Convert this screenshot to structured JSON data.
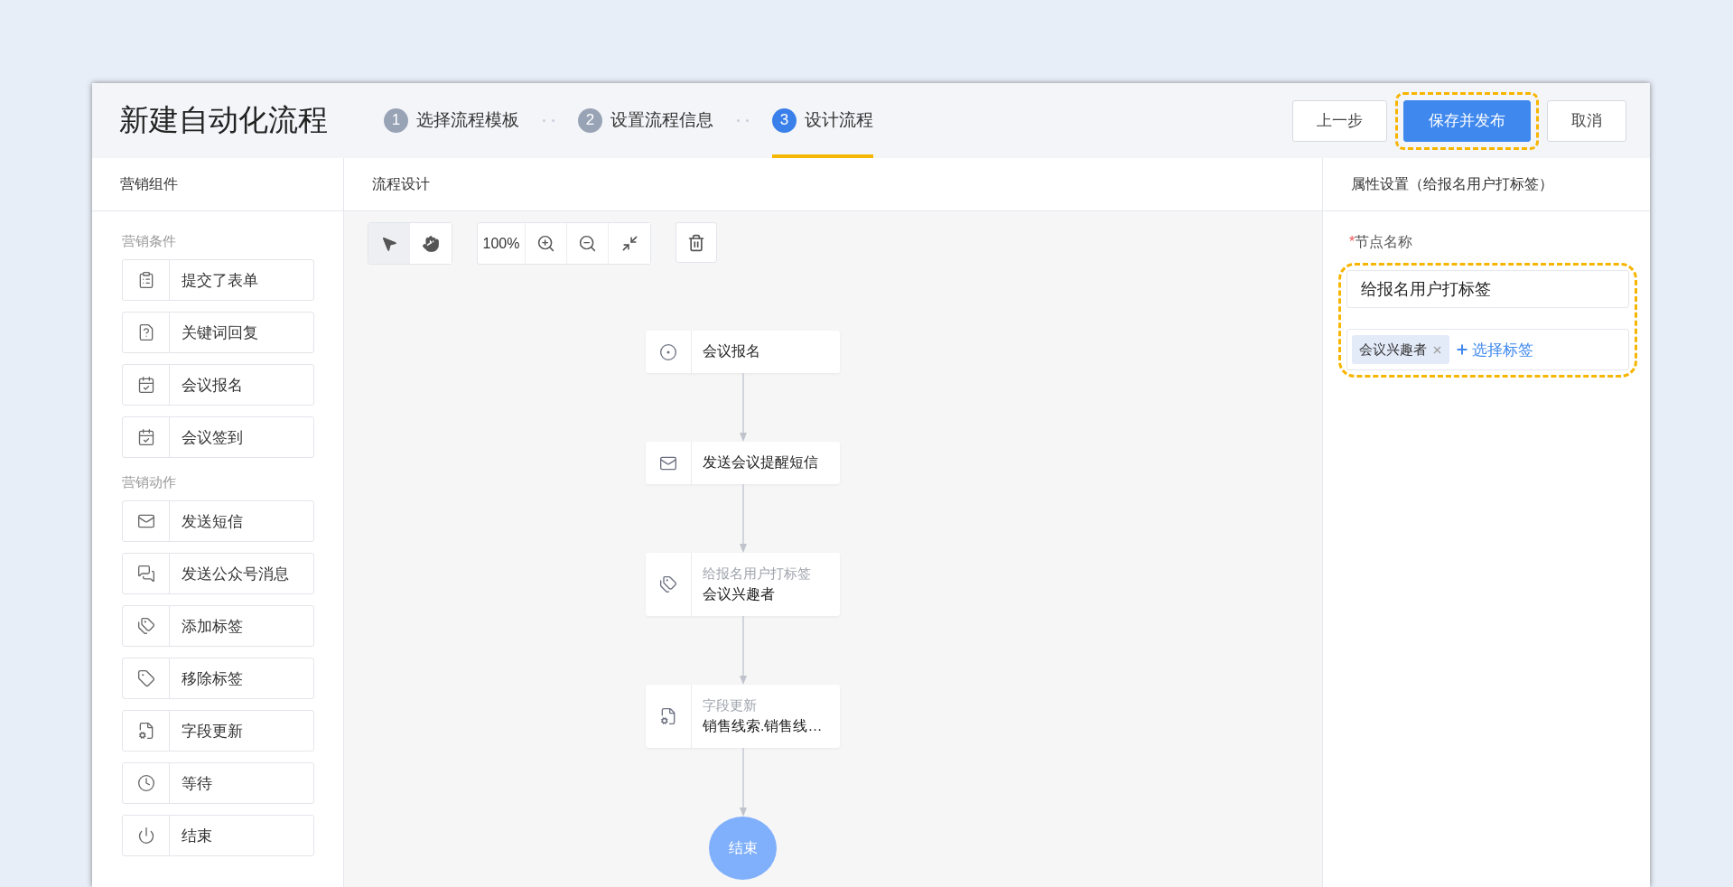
{
  "header": {
    "title": "新建自动化流程",
    "steps": [
      {
        "number": "1",
        "label": "选择流程模板",
        "selected": false
      },
      {
        "number": "2",
        "label": "设置流程信息",
        "selected": false
      },
      {
        "number": "3",
        "label": "设计流程",
        "selected": true
      }
    ],
    "buttons": [
      {
        "label": "上一步",
        "kind": "default",
        "highlighted": false
      },
      {
        "label": "保存并发布",
        "kind": "primary",
        "highlighted": true
      },
      {
        "label": "取消",
        "kind": "default",
        "highlighted": false
      }
    ]
  },
  "components_panel": {
    "title": "营销组件",
    "groups": [
      {
        "title": "营销条件",
        "items": [
          {
            "label": "提交了表单",
            "kind": "form"
          },
          {
            "label": "关键词回复",
            "kind": "keyword"
          },
          {
            "label": "会议报名",
            "kind": "calendar"
          },
          {
            "label": "会议签到",
            "kind": "calendar"
          }
        ]
      },
      {
        "title": "营销动作",
        "items": [
          {
            "label": "发送短信",
            "kind": "mail"
          },
          {
            "label": "发送公众号消息",
            "kind": "chat"
          },
          {
            "label": "添加标签",
            "kind": "tag-add"
          },
          {
            "label": "移除标签",
            "kind": "tag"
          },
          {
            "label": "字段更新",
            "kind": "field"
          },
          {
            "label": "等待",
            "kind": "clock"
          },
          {
            "label": "结束",
            "kind": "power"
          }
        ]
      }
    ]
  },
  "design_panel": {
    "title": "流程设计",
    "toolbar": {
      "zoom": "100%",
      "tools": [
        {
          "kind": "select",
          "selected": true
        },
        {
          "kind": "hand",
          "selected": false
        }
      ]
    },
    "nodes": [
      {
        "kind": "event",
        "label": "会议报名"
      },
      {
        "kind": "mail",
        "label": "发送会议提醒短信"
      },
      {
        "kind": "tag-add",
        "caption": "给报名用户打标签",
        "label": "会议兴趣者"
      },
      {
        "kind": "field",
        "caption": "字段更新",
        "label": "销售线索.销售线…"
      }
    ],
    "end": {
      "label": "结束"
    }
  },
  "properties_panel": {
    "title": "属性设置（给报名用户打标签）",
    "highlighted": true,
    "field": {
      "label": "节点名称",
      "required": true,
      "required_mark": "*",
      "value": "给报名用户打标签"
    },
    "tags": [
      {
        "label": "会议兴趣者"
      }
    ],
    "add_tag": "选择标签"
  }
}
